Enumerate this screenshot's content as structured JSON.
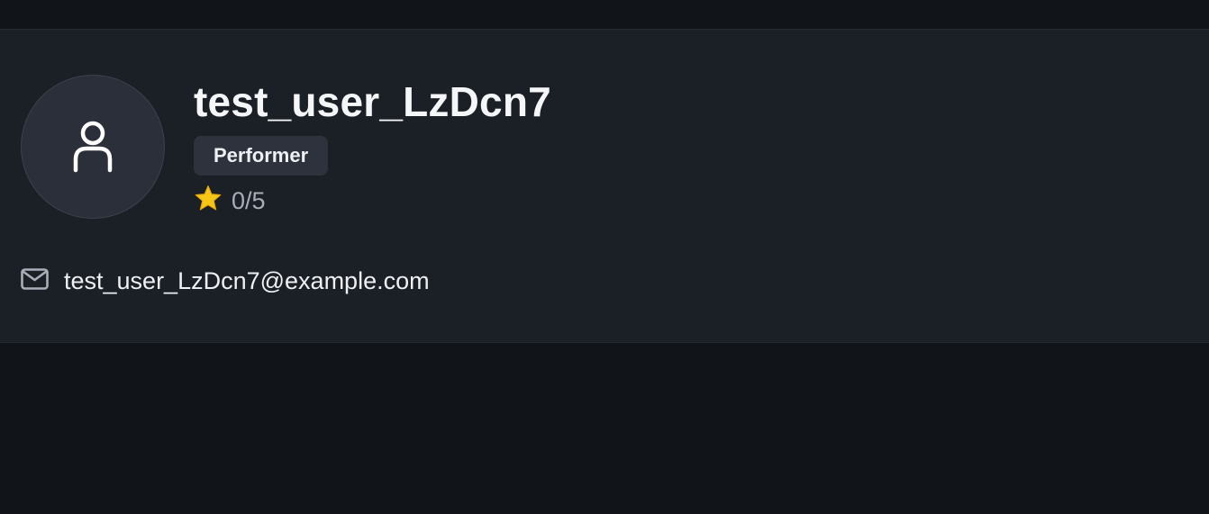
{
  "profile": {
    "avatar_icon": "user-icon",
    "username": "test_user_LzDcn7",
    "role": "Performer",
    "rating": {
      "icon": "star-icon",
      "text": "0/5",
      "value": 0,
      "max": 5
    },
    "email": {
      "icon": "mail-icon",
      "text": "test_user_LzDcn7@example.com"
    }
  },
  "colors": {
    "background": "#111419",
    "card": "#1b1f26",
    "badge": "#2e323d",
    "star": "#f5c518"
  }
}
